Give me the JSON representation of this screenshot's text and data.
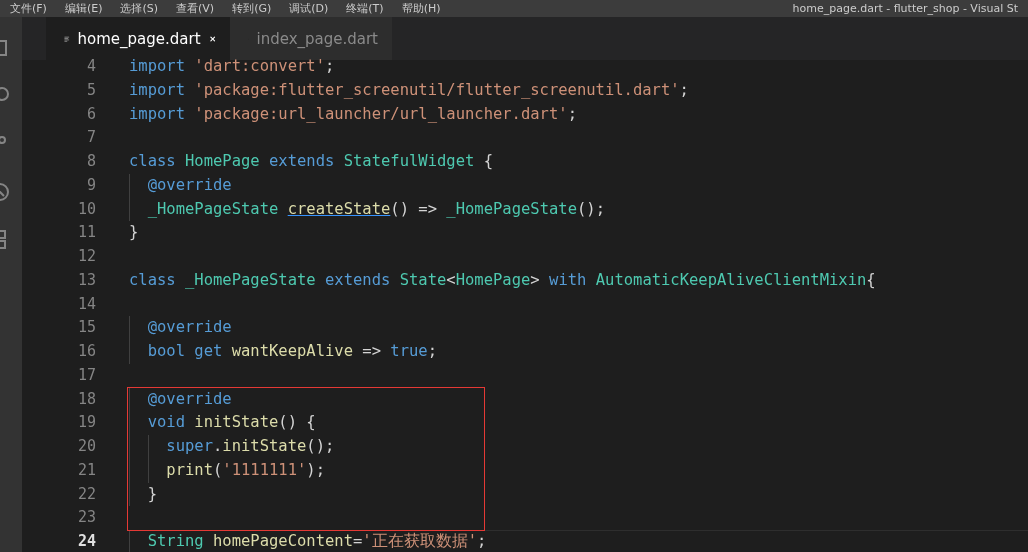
{
  "menu_bar": {
    "items": [
      "文件(F)",
      "编辑(E)",
      "选择(S)",
      "查看(V)",
      "转到(G)",
      "调试(D)",
      "终端(T)",
      "帮助(H)"
    ],
    "title": "home_page.dart - flutter_shop - Visual St"
  },
  "tabs": [
    {
      "label": "home_page.dart",
      "selected": true
    },
    {
      "label": "index_page.dart",
      "selected": false
    }
  ],
  "editor": {
    "lines": [
      {
        "number": "4",
        "current": false,
        "boxed": false,
        "tokens": [
          {
            "kind": "keyword",
            "text": "import"
          },
          {
            "kind": "string",
            "text": " 'dart:convert'"
          },
          {
            "kind": "plain",
            "text": ";"
          }
        ]
      },
      {
        "number": "5",
        "current": false,
        "boxed": false,
        "tokens": [
          {
            "kind": "keyword",
            "text": "import"
          },
          {
            "kind": "string",
            "text": " 'package:flutter_screenutil/flutter_screenutil.dart'"
          },
          {
            "kind": "plain",
            "text": ";"
          }
        ]
      },
      {
        "number": "6",
        "current": false,
        "boxed": false,
        "tokens": [
          {
            "kind": "keyword",
            "text": "import"
          },
          {
            "kind": "string",
            "text": " 'package:url_launcher/url_launcher.dart'"
          },
          {
            "kind": "plain",
            "text": ";"
          }
        ]
      },
      {
        "number": "7",
        "current": false,
        "boxed": false
      },
      {
        "number": "8",
        "current": false,
        "boxed": false,
        "tokens": [
          {
            "kind": "keyword",
            "text": "class"
          },
          {
            "kind": "type",
            "text": " HomePage"
          },
          {
            "kind": "keyword",
            "text": " extends"
          },
          {
            "kind": "type",
            "text": " StatefulWidget"
          },
          {
            "kind": "plain",
            "text": " {"
          }
        ]
      },
      {
        "number": "9",
        "current": false,
        "boxed": false,
        "tokens": [
          {
            "kind": "keyword",
            "text": "  @override"
          }
        ]
      },
      {
        "number": "10",
        "current": false,
        "boxed": false,
        "tokens": [
          {
            "kind": "type",
            "text": "  _HomePageState"
          },
          {
            "kind": "link",
            "text": " createState"
          },
          {
            "kind": "plain",
            "text": "() =>"
          },
          {
            "kind": "type",
            "text": " _HomePageState"
          },
          {
            "kind": "plain",
            "text": "();"
          }
        ]
      },
      {
        "number": "11",
        "current": false,
        "boxed": false,
        "tokens": [
          {
            "kind": "plain",
            "text": "}"
          }
        ]
      },
      {
        "number": "12",
        "current": false,
        "boxed": false
      },
      {
        "number": "13",
        "current": false,
        "boxed": false,
        "tokens": [
          {
            "kind": "keyword",
            "text": "class"
          },
          {
            "kind": "type",
            "text": " _HomePageState"
          },
          {
            "kind": "keyword",
            "text": " extends"
          },
          {
            "kind": "type",
            "text": " State"
          },
          {
            "kind": "plain",
            "text": "<"
          },
          {
            "kind": "type",
            "text": "HomePage"
          },
          {
            "kind": "plain",
            "text": ">"
          },
          {
            "kind": "keyword",
            "text": " with"
          },
          {
            "kind": "type",
            "text": " AutomaticKeepAliveClientMixin"
          },
          {
            "kind": "plain",
            "text": "{"
          }
        ]
      },
      {
        "number": "14",
        "current": false,
        "boxed": false
      },
      {
        "number": "15",
        "current": false,
        "boxed": false,
        "tokens": [
          {
            "kind": "keyword",
            "text": "  @override"
          }
        ]
      },
      {
        "number": "16",
        "current": false,
        "boxed": false,
        "tokens": [
          {
            "kind": "keyword",
            "text": "  bool"
          },
          {
            "kind": "keyword",
            "text": " get"
          },
          {
            "kind": "function",
            "text": " wantKeepAlive"
          },
          {
            "kind": "plain",
            "text": " =>"
          },
          {
            "kind": "keyword",
            "text": " true"
          },
          {
            "kind": "plain",
            "text": ";"
          }
        ]
      },
      {
        "number": "17",
        "current": false,
        "boxed": false
      },
      {
        "number": "18",
        "current": false,
        "boxed": true,
        "tokens": [
          {
            "kind": "keyword",
            "text": "  @override"
          }
        ]
      },
      {
        "number": "19",
        "current": false,
        "boxed": true,
        "tokens": [
          {
            "kind": "keyword",
            "text": "  void"
          },
          {
            "kind": "function",
            "text": " initState"
          },
          {
            "kind": "plain",
            "text": "() {"
          }
        ]
      },
      {
        "number": "20",
        "current": false,
        "boxed": true,
        "tokens": [
          {
            "kind": "keyword",
            "text": "    super"
          },
          {
            "kind": "plain",
            "text": "."
          },
          {
            "kind": "function",
            "text": "initState"
          },
          {
            "kind": "plain",
            "text": "();"
          }
        ]
      },
      {
        "number": "21",
        "current": false,
        "boxed": true,
        "tokens": [
          {
            "kind": "function",
            "text": "    print"
          },
          {
            "kind": "plain",
            "text": "("
          },
          {
            "kind": "string",
            "text": "'1111111'"
          },
          {
            "kind": "plain",
            "text": ");"
          }
        ]
      },
      {
        "number": "22",
        "current": false,
        "boxed": true,
        "tokens": [
          {
            "kind": "plain",
            "text": "  }"
          }
        ]
      },
      {
        "number": "23",
        "current": false,
        "boxed": true
      },
      {
        "number": "24",
        "current": true,
        "boxed": false,
        "tokens": [
          {
            "kind": "type",
            "text": "  String"
          },
          {
            "kind": "function",
            "text": " homePageContent"
          },
          {
            "kind": "plain",
            "text": "="
          },
          {
            "kind": "string",
            "text": "'正在获取数据'"
          },
          {
            "kind": "plain",
            "text": ";"
          }
        ]
      }
    ]
  }
}
